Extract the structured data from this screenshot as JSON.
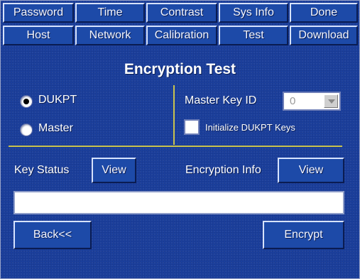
{
  "tabs_row1": [
    "Password",
    "Time",
    "Contrast",
    "Sys Info",
    "Done"
  ],
  "tabs_row2": [
    "Host",
    "Network",
    "Calibration",
    "Test",
    "Download"
  ],
  "title": "Encryption Test",
  "mode": {
    "options": [
      "DUKPT",
      "Master"
    ],
    "selected": "DUKPT"
  },
  "master_key": {
    "label": "Master Key ID",
    "value": "0"
  },
  "init_dukpt": {
    "label": "Initialize DUKPT Keys",
    "checked": false
  },
  "key_status": {
    "label": "Key Status",
    "button": "View"
  },
  "encryption_info": {
    "label": "Encryption Info",
    "button": "View"
  },
  "output": "",
  "buttons": {
    "back": "Back<<",
    "encrypt": "Encrypt"
  }
}
